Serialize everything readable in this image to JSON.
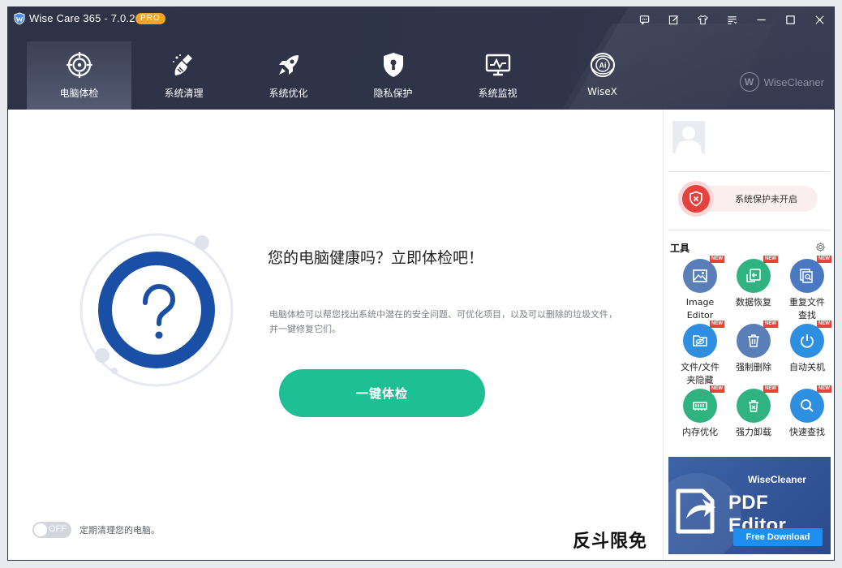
{
  "window": {
    "title": "Wise Care 365 - 7.0.2",
    "badge": "PRO"
  },
  "nav": {
    "items": [
      {
        "label": "电脑体检",
        "icon": "crosshair-icon",
        "active": true
      },
      {
        "label": "系统清理",
        "icon": "broom-icon",
        "active": false
      },
      {
        "label": "系统优化",
        "icon": "rocket-icon",
        "active": false
      },
      {
        "label": "隐私保护",
        "icon": "lock-shield-icon",
        "active": false
      },
      {
        "label": "系统监视",
        "icon": "monitor-icon",
        "active": false
      },
      {
        "label": "WiseX",
        "icon": "ai-orb-icon",
        "active": false
      }
    ],
    "brand": "WiseCleaner",
    "brand_mark": "W"
  },
  "main": {
    "headline": "您的电脑健康吗？立即体检吧！",
    "description": "电脑体检可以帮您找出系统中潜在的安全问题、可优化项目，以及可以删除的垃圾文件，并一键修复它们。",
    "scan_button": "一键体检",
    "schedule": {
      "toggle_label": "OFF",
      "text": "定期清理您的电脑。"
    },
    "watermark": "反斗限免"
  },
  "sidebar": {
    "protection_status": "系统保护未开启",
    "tools_title": "工具",
    "new_badge": "NEW",
    "tools": [
      {
        "label": "Image\nEditor",
        "icon": "image-icon",
        "color": "#5a7fb8"
      },
      {
        "label": "数据恢复",
        "icon": "recover-icon",
        "color": "#2fb380"
      },
      {
        "label": "重复文件\n查找",
        "icon": "duplicate-search-icon",
        "color": "#4b78c2"
      },
      {
        "label": "文件/文件\n夹隐藏",
        "icon": "folder-hide-icon",
        "color": "#2e8fe0"
      },
      {
        "label": "强制删除",
        "icon": "trash-icon",
        "color": "#5a7fb8"
      },
      {
        "label": "自动关机",
        "icon": "power-icon",
        "color": "#2e8fe0"
      },
      {
        "label": "内存优化",
        "icon": "memory-icon",
        "color": "#2fb380"
      },
      {
        "label": "强力卸载",
        "icon": "uninstall-icon",
        "color": "#2fb380"
      },
      {
        "label": "快速查找",
        "icon": "magnifier-icon",
        "color": "#2e8fe0"
      }
    ],
    "ad": {
      "brand": "WiseCleaner",
      "product": "PDF Editor",
      "cta": "Free Download"
    }
  },
  "colors": {
    "header_bg": "#2f3449",
    "accent_green": "#1ebf95",
    "ring_blue": "#1a4fa6",
    "warning_red": "#e5413d",
    "new_badge_red": "#e5413d"
  }
}
